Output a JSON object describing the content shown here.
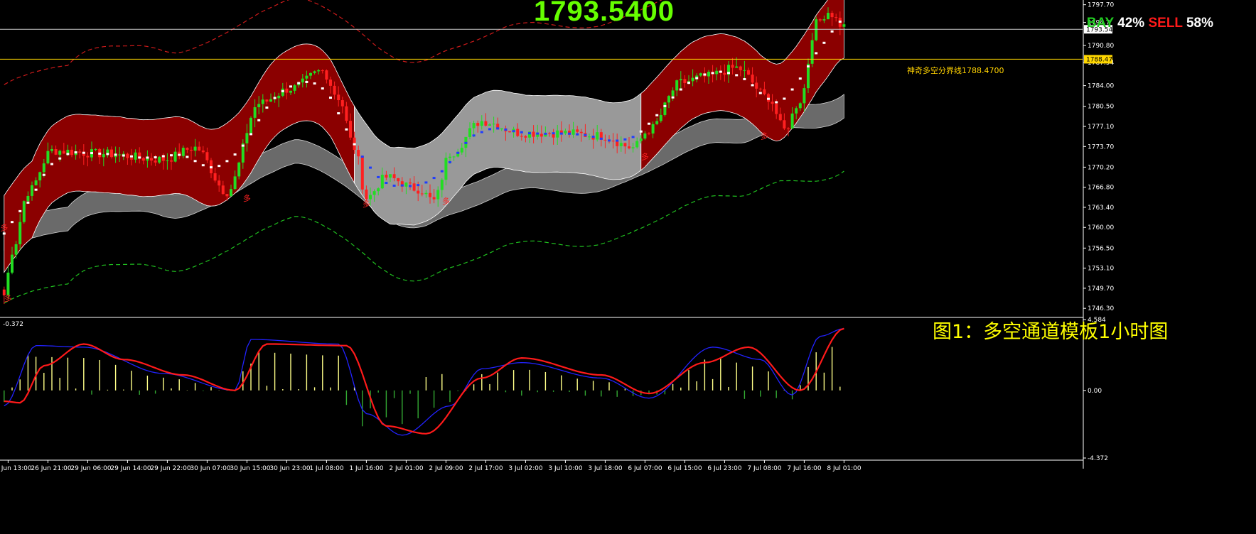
{
  "header": {
    "big_price": "1793.5400",
    "bay_label": "BAY",
    "bay_pct": "42%",
    "sell_label": "SELL",
    "sell_pct": "58%"
  },
  "caption": "图1：多空通道模板1小时图",
  "separator_label": "神奇多空分界线1788.4700",
  "price_tags": [
    "1793.54",
    "1788.47"
  ],
  "indicator_label": "-0.372",
  "colors": {
    "background": "#000000",
    "bull_candle": "#22dd22",
    "bear_candle": "#ff2020",
    "channel_red": "#8b0000",
    "channel_gray": "#999999",
    "dashed_upper": "#cc1a1a",
    "dashed_lower": "#1fbf1f",
    "signal_line": "#ff1a1a",
    "macd_line": "#2222ff",
    "hist_pos": "#ffff88",
    "hist_neg": "#33aa33",
    "marker": "#ff2222"
  },
  "markers": {
    "label": "多",
    "points": [
      {
        "time": "26 Jun 13:00",
        "price": 1747.5
      },
      {
        "time": "30 Jun 15:00",
        "price": 1764.5
      },
      {
        "time": "1 Jul 16:00",
        "price": 1763.5
      },
      {
        "time": "2 Jul 09:00",
        "price": 1764.0
      },
      {
        "time": "2 Jul 16:00",
        "price": 1759.5
      },
      {
        "time": "6 Jul 07:00",
        "price": 1771.5
      },
      {
        "time": "7 Jul 08:00",
        "price": 1775.0
      }
    ]
  },
  "chart_data": [
    {
      "type": "candlestick",
      "title": "",
      "xlabel": "",
      "ylabel": "",
      "ylim": [
        1745.0,
        1798.5
      ],
      "y_ticks": [
        "1797.70",
        "1794.7",
        "1790.80",
        "1787.94",
        "1784.00",
        "1780.50",
        "1777.10",
        "1773.70",
        "1770.20",
        "1766.80",
        "1763.40",
        "1760.00",
        "1756.50",
        "1753.10",
        "1749.70",
        "1746.30"
      ],
      "x_ticks": [
        "26 Jun 13:00",
        "26 Jun 21:00",
        "29 Jun 06:00",
        "29 Jun 14:00",
        "29 Jun 22:00",
        "30 Jun 07:00",
        "30 Jun 15:00",
        "30 Jun 23:00",
        "1 Jul 08:00",
        "1 Jul 16:00",
        "2 Jul 01:00",
        "2 Jul 09:00",
        "2 Jul 17:00",
        "3 Jul 02:00",
        "3 Jul 10:00",
        "3 Jul 18:00",
        "6 Jul 07:00",
        "6 Jul 15:00",
        "6 Jul 23:00",
        "7 Jul 08:00",
        "7 Jul 16:00",
        "8 Jul 01:00"
      ],
      "grid": false,
      "horizontal_lines": [
        1793.54,
        1788.47
      ],
      "close_anchors": [
        {
          "bar": 0,
          "close": 1748.5
        },
        {
          "bar": 2,
          "close": 1756.0
        },
        {
          "bar": 6,
          "close": 1766.0
        },
        {
          "bar": 12,
          "close": 1773.0
        },
        {
          "bar": 24,
          "close": 1772.5
        },
        {
          "bar": 40,
          "close": 1771.5
        },
        {
          "bar": 48,
          "close": 1773.5
        },
        {
          "bar": 56,
          "close": 1766.0
        },
        {
          "bar": 64,
          "close": 1781.0
        },
        {
          "bar": 72,
          "close": 1783.5
        },
        {
          "bar": 80,
          "close": 1786.5
        },
        {
          "bar": 84,
          "close": 1782.0
        },
        {
          "bar": 88,
          "close": 1773.5
        },
        {
          "bar": 91,
          "close": 1765.0
        },
        {
          "bar": 96,
          "close": 1768.5
        },
        {
          "bar": 104,
          "close": 1766.5
        },
        {
          "bar": 108,
          "close": 1764.5
        },
        {
          "bar": 112,
          "close": 1772.5
        },
        {
          "bar": 120,
          "close": 1778.0
        },
        {
          "bar": 130,
          "close": 1776.0
        },
        {
          "bar": 140,
          "close": 1776.0
        },
        {
          "bar": 150,
          "close": 1775.5
        },
        {
          "bar": 158,
          "close": 1773.5
        },
        {
          "bar": 162,
          "close": 1776.5
        },
        {
          "bar": 170,
          "close": 1784.5
        },
        {
          "bar": 176,
          "close": 1785.5
        },
        {
          "bar": 184,
          "close": 1787.0
        },
        {
          "bar": 192,
          "close": 1782.0
        },
        {
          "bar": 196,
          "close": 1776.5
        },
        {
          "bar": 200,
          "close": 1781.5
        },
        {
          "bar": 204,
          "close": 1794.5
        },
        {
          "bar": 207,
          "close": 1796.5
        },
        {
          "bar": 211,
          "close": 1794.0
        }
      ]
    },
    {
      "type": "histogram",
      "title": "",
      "ylim": [
        -4.372,
        4.584
      ],
      "y_ticks": [
        "4.584",
        "0.00",
        "-4.372"
      ],
      "signal_keypoints": [
        {
          "bar": 0,
          "value": -0.7
        },
        {
          "bar": 4,
          "value": -0.8
        },
        {
          "bar": 10,
          "value": 1.6
        },
        {
          "bar": 20,
          "value": 3.0
        },
        {
          "bar": 30,
          "value": 2.0
        },
        {
          "bar": 45,
          "value": 1.0
        },
        {
          "bar": 58,
          "value": 0.0
        },
        {
          "bar": 66,
          "value": 3.0
        },
        {
          "bar": 86,
          "value": 2.9
        },
        {
          "bar": 96,
          "value": -2.3
        },
        {
          "bar": 106,
          "value": -2.8
        },
        {
          "bar": 120,
          "value": 0.8
        },
        {
          "bar": 130,
          "value": 2.1
        },
        {
          "bar": 150,
          "value": 1.0
        },
        {
          "bar": 162,
          "value": -0.2
        },
        {
          "bar": 176,
          "value": 1.8
        },
        {
          "bar": 187,
          "value": 2.8
        },
        {
          "bar": 200,
          "value": 0.0
        },
        {
          "bar": 211,
          "value": 4.0
        }
      ],
      "macd_keypoints": [
        {
          "bar": 0,
          "value": -1.0
        },
        {
          "bar": 8,
          "value": 2.9
        },
        {
          "bar": 20,
          "value": 2.8
        },
        {
          "bar": 40,
          "value": 1.1
        },
        {
          "bar": 58,
          "value": 0.0
        },
        {
          "bar": 62,
          "value": 3.3
        },
        {
          "bar": 84,
          "value": 3.0
        },
        {
          "bar": 91,
          "value": -1.5
        },
        {
          "bar": 100,
          "value": -2.9
        },
        {
          "bar": 112,
          "value": -1.0
        },
        {
          "bar": 120,
          "value": 1.4
        },
        {
          "bar": 130,
          "value": 1.8
        },
        {
          "bar": 150,
          "value": 0.8
        },
        {
          "bar": 162,
          "value": -0.5
        },
        {
          "bar": 178,
          "value": 2.8
        },
        {
          "bar": 190,
          "value": 2.0
        },
        {
          "bar": 198,
          "value": -0.3
        },
        {
          "bar": 205,
          "value": 3.5
        },
        {
          "bar": 211,
          "value": 4.0
        }
      ]
    }
  ]
}
